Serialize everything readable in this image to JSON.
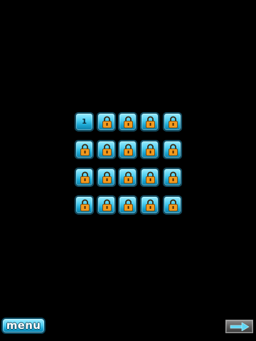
{
  "levels": [
    {
      "label": "1",
      "locked": false
    },
    {
      "label": "",
      "locked": true
    },
    {
      "label": "",
      "locked": true
    },
    {
      "label": "",
      "locked": true
    },
    {
      "label": "",
      "locked": true
    },
    {
      "label": "",
      "locked": true
    },
    {
      "label": "",
      "locked": true
    },
    {
      "label": "",
      "locked": true
    },
    {
      "label": "",
      "locked": true
    },
    {
      "label": "",
      "locked": true
    },
    {
      "label": "",
      "locked": true
    },
    {
      "label": "",
      "locked": true
    },
    {
      "label": "",
      "locked": true
    },
    {
      "label": "",
      "locked": true
    },
    {
      "label": "",
      "locked": true
    },
    {
      "label": "",
      "locked": true
    },
    {
      "label": "",
      "locked": true
    },
    {
      "label": "",
      "locked": true
    },
    {
      "label": "",
      "locked": true
    },
    {
      "label": "",
      "locked": true
    }
  ],
  "menu": {
    "label": "menu"
  },
  "next": {
    "icon": "arrow-right-icon"
  },
  "colors": {
    "background": "#000000",
    "tile": "#2bb6e0",
    "lock": "#f39a1e"
  }
}
